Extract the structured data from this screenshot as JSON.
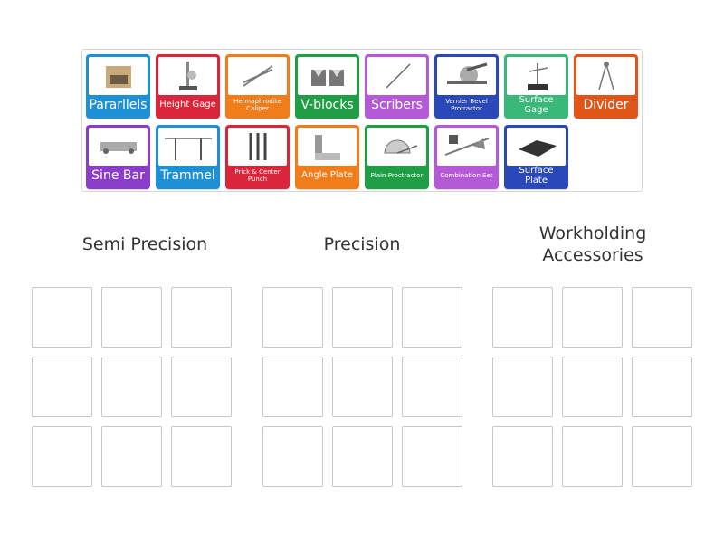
{
  "cards": [
    {
      "label": "Pararllels",
      "size": "big",
      "color": "#1e90d6",
      "icon": "parallels-image"
    },
    {
      "label": "Height Gage",
      "size": "mid",
      "color": "#d9263a",
      "icon": "height-gage-image"
    },
    {
      "label": "Hermaphrodite Caliper",
      "size": "small",
      "color": "#f07d1a",
      "icon": "hermaphrodite-caliper-image"
    },
    {
      "label": "V-blocks",
      "size": "big",
      "color": "#1f9e46",
      "icon": "v-blocks-image"
    },
    {
      "label": "Scribers",
      "size": "big",
      "color": "#b55ad6",
      "icon": "scribers-image"
    },
    {
      "label": "Vernier Bevel Protractor",
      "size": "small",
      "color": "#2a48b8",
      "icon": "vernier-bevel-protractor-image"
    },
    {
      "label": "Surface Gage",
      "size": "mid",
      "color": "#3ab87a",
      "icon": "surface-gage-image"
    },
    {
      "label": "Divider",
      "size": "big",
      "color": "#e05518",
      "icon": "divider-image"
    },
    {
      "label": "Sine Bar",
      "size": "big",
      "color": "#8a3dc8",
      "icon": "sine-bar-image"
    },
    {
      "label": "Trammel",
      "size": "big",
      "color": "#1e90d6",
      "icon": "trammel-image"
    },
    {
      "label": "Prick & Center Punch",
      "size": "small",
      "color": "#d9263a",
      "icon": "prick-center-punch-image"
    },
    {
      "label": "Angle Plate",
      "size": "mid",
      "color": "#f07d1a",
      "icon": "angle-plate-image"
    },
    {
      "label": "Plain Proctractor",
      "size": "small",
      "color": "#1f9e46",
      "icon": "plain-protractor-image"
    },
    {
      "label": "Combination Set",
      "size": "small",
      "color": "#b55ad6",
      "icon": "combination-set-image"
    },
    {
      "label": "Surface Plate",
      "size": "mid",
      "color": "#2a48b8",
      "icon": "surface-plate-image"
    }
  ],
  "groups": [
    {
      "title": "Semi Precision"
    },
    {
      "title": "Precision"
    },
    {
      "title": "Workholding Accessories"
    }
  ]
}
